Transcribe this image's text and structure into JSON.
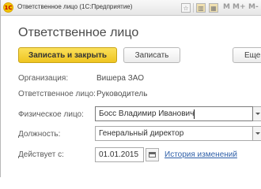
{
  "window": {
    "app_logo_text": "1С",
    "title": "Ответственное лицо (1С:Предприятие)",
    "toolbar_letters": [
      "M",
      "M+",
      "M-"
    ]
  },
  "form": {
    "heading": "Ответственное лицо"
  },
  "commands": {
    "save_close_label": "Записать и закрыть",
    "save_label": "Записать",
    "more_label": "Еще"
  },
  "fields": {
    "organization": {
      "label": "Организация:",
      "value": "Вишера ЗАО"
    },
    "responsible": {
      "label": "Ответственное лицо:",
      "value": "Руководитель"
    },
    "person": {
      "label": "Физическое лицо:",
      "value": "Босс Владимир Иванович"
    },
    "position": {
      "label": "Должность:",
      "value": "Генеральный директор"
    },
    "valid_from": {
      "label": "Действует с:",
      "value": "01.01.2015"
    },
    "history_link": "История изменений"
  },
  "colors": {
    "primary_button": "#f5d33a",
    "link": "#2e5fa8"
  }
}
